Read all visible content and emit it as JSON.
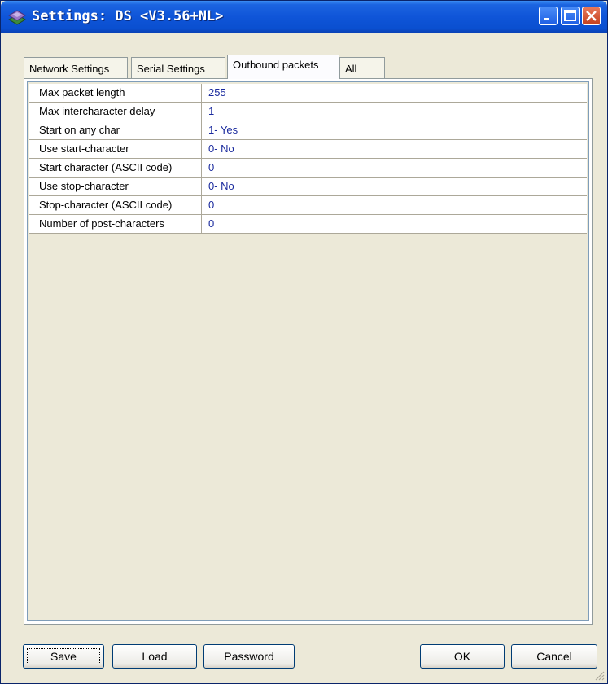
{
  "window": {
    "title": "Settings: DS <V3.56+NL>",
    "icon": "ds-settings-icon"
  },
  "title_buttons": [
    "minimize-icon",
    "maximize-icon",
    "close-icon"
  ],
  "tabs": [
    {
      "label": "Network Settings",
      "active": false
    },
    {
      "label": "Serial Settings",
      "active": false
    },
    {
      "label": "Outbound packets",
      "active": true
    },
    {
      "label": "All",
      "active": false
    }
  ],
  "properties": [
    {
      "name": "Max packet length",
      "value": "255"
    },
    {
      "name": "Max intercharacter delay",
      "value": "1"
    },
    {
      "name": "Start on any char",
      "value": "1- Yes"
    },
    {
      "name": "Use start-character",
      "value": "0- No"
    },
    {
      "name": "Start character (ASCII code)",
      "value": "0"
    },
    {
      "name": "Use stop-character",
      "value": "0- No"
    },
    {
      "name": "Stop-character (ASCII code)",
      "value": "0"
    },
    {
      "name": "Number of post-characters",
      "value": "0"
    }
  ],
  "buttons": {
    "save": "Save",
    "load": "Load",
    "password": "Password",
    "ok": "OK",
    "cancel": "Cancel"
  },
  "colors": {
    "title_bar": "#0f55d8",
    "value_text": "#1b2b9e",
    "face": "#ece9d8"
  }
}
